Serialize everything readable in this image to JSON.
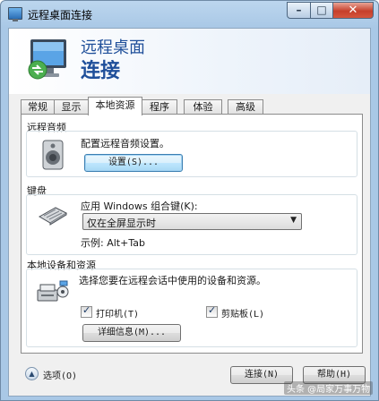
{
  "window": {
    "title": "远程桌面连接",
    "controls": {
      "minimize": "–",
      "maximize": "□",
      "close": "✕"
    }
  },
  "banner": {
    "line1": "远程桌面",
    "line2": "连接",
    "icon": "remote-desktop-icon"
  },
  "tabs": [
    {
      "label": "常规",
      "active": false
    },
    {
      "label": "显示",
      "active": false
    },
    {
      "label": "本地资源",
      "active": true
    },
    {
      "label": "程序",
      "active": false
    },
    {
      "label": "体验",
      "active": false
    },
    {
      "label": "高级",
      "active": false
    }
  ],
  "audio": {
    "group_label": "远程音频",
    "description": "配置远程音频设置。",
    "settings_button": "设置(S)...",
    "icon": "speaker-icon"
  },
  "keyboard": {
    "group_label": "键盘",
    "apply_label": "应用 Windows 组合键(K):",
    "selected_option": "仅在全屏显示时",
    "example": "示例: Alt+Tab",
    "icon": "keyboard-icon"
  },
  "local_devices": {
    "group_label": "本地设备和资源",
    "description": "选择您要在远程会话中使用的设备和资源。",
    "printer_label": "打印机(T)",
    "printer_checked": true,
    "clipboard_label": "剪贴板(L)",
    "clipboard_checked": true,
    "details_button": "详细信息(M)...",
    "icon": "devices-icon"
  },
  "footer": {
    "options_label": "选项(O)",
    "connect_button": "连接(N)",
    "help_button": "帮助(H)"
  },
  "watermark": "头条 @局家万事万物"
}
